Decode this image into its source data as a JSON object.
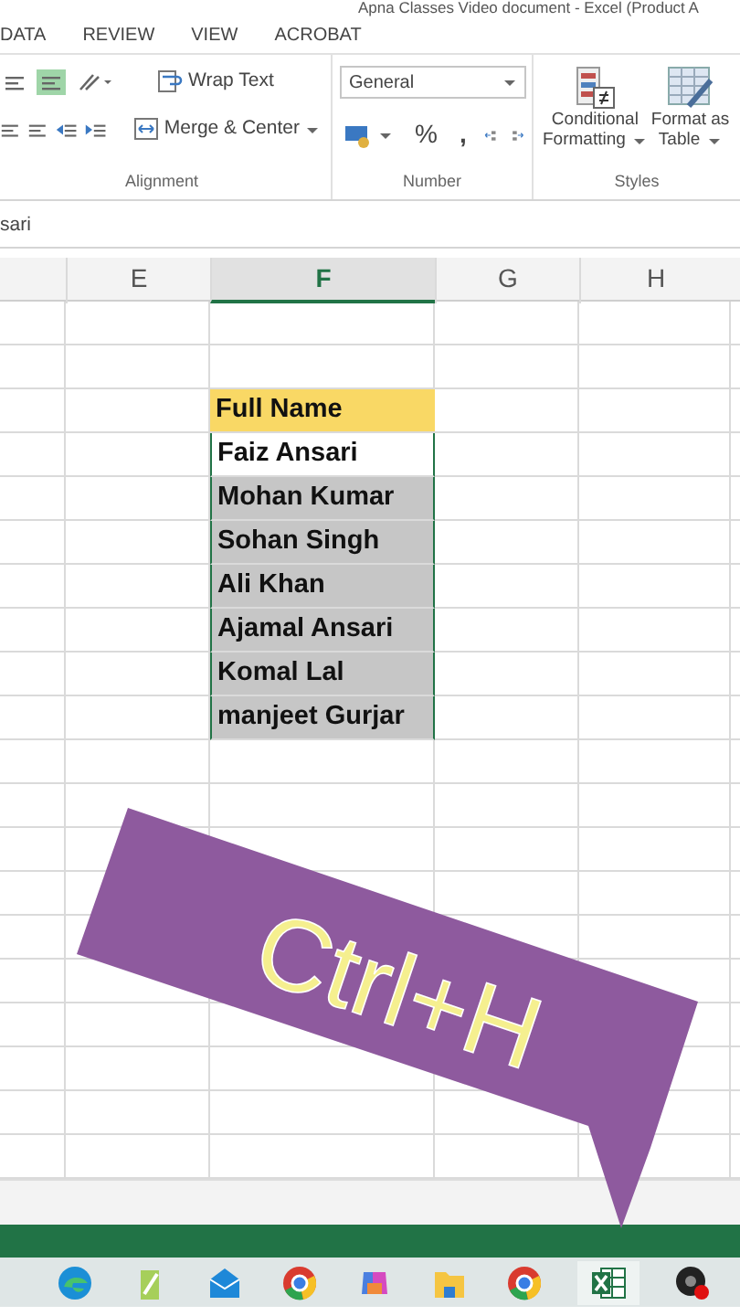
{
  "window": {
    "title": "Apna Classes Video document - Excel (Product A"
  },
  "ribbon_tabs": [
    "DATA",
    "REVIEW",
    "VIEW",
    "ACROBAT"
  ],
  "alignment_group": {
    "label": "Alignment",
    "align_buttons": [
      {
        "selected": false
      },
      {
        "selected": true
      }
    ],
    "wrap_text": "Wrap Text",
    "merge_center": "Merge & Center"
  },
  "number_group": {
    "label": "Number",
    "format": "General",
    "percent": "%",
    "comma": ","
  },
  "styles_group": {
    "label": "Styles",
    "buttons": [
      {
        "kind": "conditional",
        "line1": "Conditional",
        "line2": "Formatting"
      },
      {
        "kind": "table",
        "line1": "Format as",
        "line2": "Table"
      }
    ]
  },
  "formula_bar": {
    "value": "sari"
  },
  "columns": [
    {
      "label": "E",
      "selected": false
    },
    {
      "label": "F",
      "selected": true
    },
    {
      "label": "G",
      "selected": false
    },
    {
      "label": "H",
      "selected": false
    }
  ],
  "column_f_cells": [
    {
      "text": "Full Name",
      "kind": "header",
      "selected": false,
      "active": false
    },
    {
      "text": "Faiz Ansari",
      "kind": "data",
      "selected": true,
      "active": true
    },
    {
      "text": "Mohan Kumar",
      "kind": "data",
      "selected": true,
      "active": false
    },
    {
      "text": "Sohan Singh",
      "kind": "data",
      "selected": true,
      "active": false
    },
    {
      "text": "Ali Khan",
      "kind": "data",
      "selected": true,
      "active": false
    },
    {
      "text": "Ajamal Ansari",
      "kind": "data",
      "selected": true,
      "active": false
    },
    {
      "text": "Komal Lal",
      "kind": "data",
      "selected": true,
      "active": false
    },
    {
      "text": "manjeet Gurjar",
      "kind": "data",
      "selected": true,
      "active": false
    }
  ],
  "overlay": {
    "text": "Ctrl+H"
  },
  "taskbar": {
    "apps": [
      {
        "kind": "edge",
        "selected": false
      },
      {
        "kind": "pencil",
        "selected": false
      },
      {
        "kind": "mail",
        "selected": false
      },
      {
        "kind": "chrome",
        "selected": false
      },
      {
        "kind": "copilot",
        "selected": false
      },
      {
        "kind": "folder",
        "selected": false
      },
      {
        "kind": "chrome",
        "selected": false
      },
      {
        "kind": "excel",
        "selected": true
      },
      {
        "kind": "recorder",
        "selected": false
      }
    ]
  }
}
